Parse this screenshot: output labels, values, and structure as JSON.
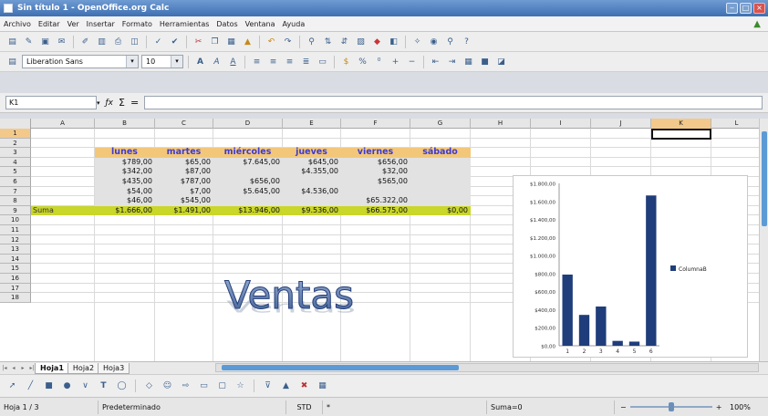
{
  "window": {
    "title": "Sin título 1 - OpenOffice.org Calc"
  },
  "menu": [
    "Archivo",
    "Editar",
    "Ver",
    "Insertar",
    "Formato",
    "Herramientas",
    "Datos",
    "Ventana",
    "Ayuda"
  ],
  "font": {
    "name": "Liberation Sans",
    "size": "10"
  },
  "formula": {
    "cell_ref": "K1",
    "fx": "ƒx",
    "sigma": "Σ",
    "equals": "=",
    "value": ""
  },
  "columns": [
    "A",
    "B",
    "C",
    "D",
    "E",
    "F",
    "G",
    "H",
    "I",
    "J",
    "K",
    "L"
  ],
  "active_column": "K",
  "active_row": "1",
  "rows": [
    "1",
    "2",
    "3",
    "4",
    "5",
    "6",
    "7",
    "8",
    "9",
    "10",
    "11",
    "12",
    "13",
    "14",
    "15",
    "16",
    "17",
    "18"
  ],
  "table": {
    "headers": [
      "lunes",
      "martes",
      "miércoles",
      "jueves",
      "viernes",
      "sábado"
    ],
    "data": [
      [
        "$789,00",
        "$65,00",
        "$7.645,00",
        "$645,00",
        "$656,00",
        ""
      ],
      [
        "$342,00",
        "$87,00",
        "",
        "$4.355,00",
        "$32,00",
        ""
      ],
      [
        "$435,00",
        "$787,00",
        "$656,00",
        "",
        "$565,00",
        ""
      ],
      [
        "$54,00",
        "$7,00",
        "$5.645,00",
        "$4.536,00",
        "",
        ""
      ],
      [
        "$46,00",
        "$545,00",
        "",
        "",
        "$65.322,00",
        ""
      ]
    ],
    "sum_label": "Suma",
    "sums": [
      "$1.666,00",
      "$1.491,00",
      "$13.946,00",
      "$9.536,00",
      "$66.575,00",
      "$0,00"
    ]
  },
  "wordart": {
    "text": "Ventas"
  },
  "chart_data": {
    "type": "bar",
    "categories": [
      "1",
      "2",
      "3",
      "4",
      "5",
      "6"
    ],
    "series": [
      {
        "name": "ColumnaB",
        "values": [
          789,
          342,
          435,
          54,
          46,
          1666
        ]
      }
    ],
    "yticks": [
      "$0,00",
      "$200,00",
      "$400,00",
      "$600,00",
      "$800,00",
      "$1.000,00",
      "$1.200,00",
      "$1.400,00",
      "$1.600,00",
      "$1.800,00"
    ],
    "ylim": [
      0,
      1800
    ],
    "legend_position": "right",
    "grid": false,
    "bar_color": "#1f3d7a"
  },
  "sheets": [
    "Hoja1",
    "Hoja2",
    "Hoja3"
  ],
  "active_sheet": "Hoja1",
  "status": {
    "page": "Hoja 1 / 3",
    "style": "Predeterminado",
    "mode": "STD",
    "modified": "*",
    "sum": "Suma=0",
    "zoom": "100%",
    "zoom_level": 0.5
  },
  "colors": {
    "header_fill": "#f3c77a",
    "sum_fill": "#c9d62a",
    "data_fill": "#e2e2e2",
    "header_text": "#3d3ad1",
    "active": "#f2c98a"
  }
}
